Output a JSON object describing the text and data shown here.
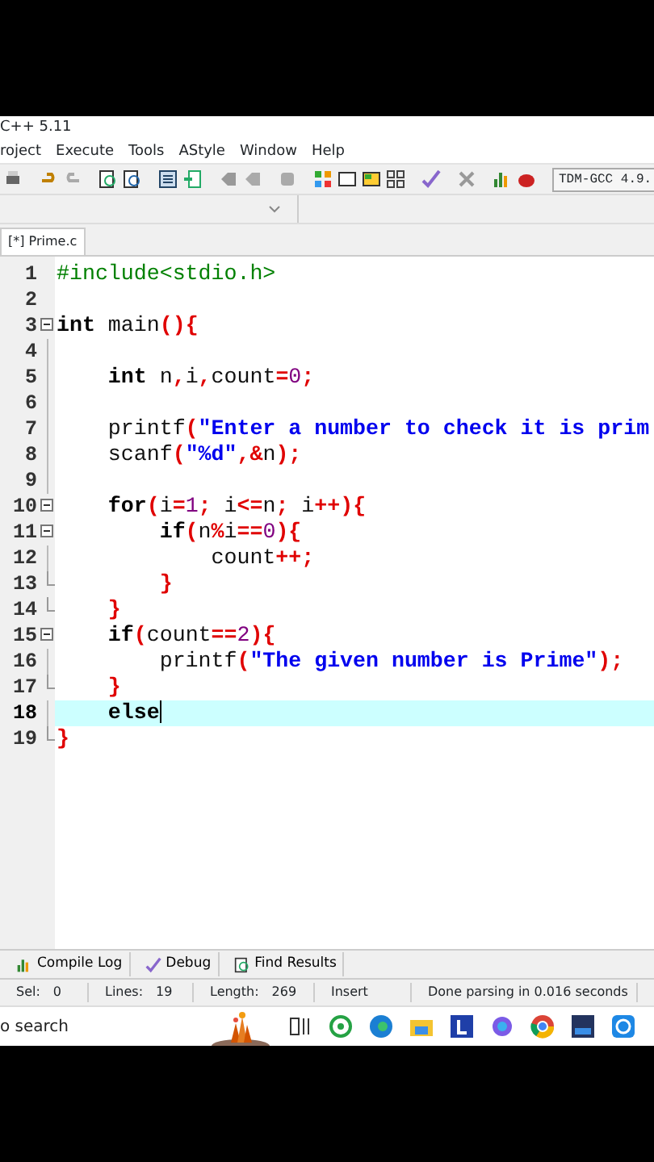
{
  "window": {
    "title": "C++ 5.11"
  },
  "menu": [
    "roject",
    "Execute",
    "Tools",
    "AStyle",
    "Window",
    "Help"
  ],
  "compiler": {
    "value": "TDM-GCC 4.9."
  },
  "tabs": [
    {
      "label": "[*] Prime.c",
      "selected": true
    }
  ],
  "editor": {
    "lines": [
      {
        "number": "1",
        "highlighted": false,
        "tokens": [
          {
            "text": "#include<stdio.h>",
            "kind": "pre"
          }
        ]
      },
      {
        "number": "2",
        "highlighted": false
      },
      {
        "number": "3",
        "kind": "open",
        "highlighted": false,
        "tokens": [
          {
            "text": "int",
            "kind": "kw"
          },
          {
            "text": " main",
            "kind": "plain"
          },
          {
            "text": "(){",
            "kind": "sym"
          }
        ]
      },
      {
        "number": "4",
        "kind": "line",
        "highlighted": false
      },
      {
        "number": "5",
        "kind": "line",
        "highlighted": false,
        "tokens": [
          {
            "text": "    int",
            "kind": "kw"
          },
          {
            "text": " n",
            "kind": "plain"
          },
          {
            "text": ",",
            "kind": "sym"
          },
          {
            "text": "i",
            "kind": "plain"
          },
          {
            "text": ",",
            "kind": "sym"
          },
          {
            "text": "count",
            "kind": "plain"
          },
          {
            "text": "=",
            "kind": "sym"
          },
          {
            "text": "0",
            "kind": "num"
          },
          {
            "text": ";",
            "kind": "sym"
          }
        ]
      },
      {
        "number": "6",
        "kind": "line",
        "highlighted": false
      },
      {
        "number": "7",
        "kind": "line",
        "highlighted": false,
        "tokens": [
          {
            "text": "    printf",
            "kind": "plain"
          },
          {
            "text": "(",
            "kind": "sym"
          },
          {
            "text": "\"Enter a number to check it is prim",
            "kind": "str"
          }
        ]
      },
      {
        "number": "8",
        "kind": "line",
        "highlighted": false,
        "tokens": [
          {
            "text": "    scanf",
            "kind": "plain"
          },
          {
            "text": "(",
            "kind": "sym"
          },
          {
            "text": "\"%d\"",
            "kind": "str"
          },
          {
            "text": ",&",
            "kind": "sym"
          },
          {
            "text": "n",
            "kind": "plain"
          },
          {
            "text": ");",
            "kind": "sym"
          }
        ]
      },
      {
        "number": "9",
        "kind": "line",
        "highlighted": false
      },
      {
        "number": "10",
        "kind": "open",
        "highlighted": false,
        "tokens": [
          {
            "text": "    for",
            "kind": "kw"
          },
          {
            "text": "(",
            "kind": "sym"
          },
          {
            "text": "i",
            "kind": "plain"
          },
          {
            "text": "=",
            "kind": "sym"
          },
          {
            "text": "1",
            "kind": "num"
          },
          {
            "text": ";",
            "kind": "sym"
          },
          {
            "text": " i",
            "kind": "plain"
          },
          {
            "text": "<=",
            "kind": "sym"
          },
          {
            "text": "n",
            "kind": "plain"
          },
          {
            "text": ";",
            "kind": "sym"
          },
          {
            "text": " i",
            "kind": "plain"
          },
          {
            "text": "++){",
            "kind": "sym"
          }
        ]
      },
      {
        "number": "11",
        "kind": "open",
        "highlighted": false,
        "tokens": [
          {
            "text": "        if",
            "kind": "kw"
          },
          {
            "text": "(",
            "kind": "sym"
          },
          {
            "text": "n",
            "kind": "plain"
          },
          {
            "text": "%",
            "kind": "sym"
          },
          {
            "text": "i",
            "kind": "plain"
          },
          {
            "text": "==",
            "kind": "sym"
          },
          {
            "text": "0",
            "kind": "num"
          },
          {
            "text": "){",
            "kind": "sym"
          }
        ]
      },
      {
        "number": "12",
        "kind": "line",
        "highlighted": false,
        "tokens": [
          {
            "text": "            count",
            "kind": "plain"
          },
          {
            "text": "++;",
            "kind": "sym"
          }
        ]
      },
      {
        "number": "13",
        "kind": "end",
        "highlighted": false,
        "tokens": [
          {
            "text": "        }",
            "kind": "sym"
          }
        ]
      },
      {
        "number": "14",
        "kind": "end",
        "highlighted": false,
        "tokens": [
          {
            "text": "    }",
            "kind": "sym"
          }
        ]
      },
      {
        "number": "15",
        "kind": "open",
        "highlighted": false,
        "tokens": [
          {
            "text": "    if",
            "kind": "kw"
          },
          {
            "text": "(",
            "kind": "sym"
          },
          {
            "text": "count",
            "kind": "plain"
          },
          {
            "text": "==",
            "kind": "sym"
          },
          {
            "text": "2",
            "kind": "num"
          },
          {
            "text": "){",
            "kind": "sym"
          }
        ]
      },
      {
        "number": "16",
        "kind": "line",
        "highlighted": false,
        "tokens": [
          {
            "text": "        printf",
            "kind": "plain"
          },
          {
            "text": "(",
            "kind": "sym"
          },
          {
            "text": "\"The given number is Prime\"",
            "kind": "str"
          },
          {
            "text": ");",
            "kind": "sym"
          }
        ]
      },
      {
        "number": "17",
        "kind": "end",
        "highlighted": false,
        "tokens": [
          {
            "text": "    }",
            "kind": "sym"
          }
        ]
      },
      {
        "number": "18",
        "kind": "line",
        "highlighted": true,
        "tokens": [
          {
            "text": "    else",
            "kind": "kw"
          }
        ]
      },
      {
        "number": "19",
        "kind": "end",
        "highlighted": false,
        "tokens": [
          {
            "text": "}",
            "kind": "sym"
          }
        ]
      }
    ]
  },
  "bottom_tabs": [
    {
      "label": "Compile Log"
    },
    {
      "label": "Debug"
    },
    {
      "label": "Find Results"
    }
  ],
  "status_bar": [
    {
      "label": "Sel:",
      "value": "0"
    },
    {
      "label": "Lines:",
      "value": "19"
    },
    {
      "label": "Length:",
      "value": "269"
    },
    {
      "value": "Insert"
    },
    {
      "value": "Done parsing in 0.016 seconds"
    }
  ],
  "taskbar": {
    "search_placeholder": "o search"
  }
}
